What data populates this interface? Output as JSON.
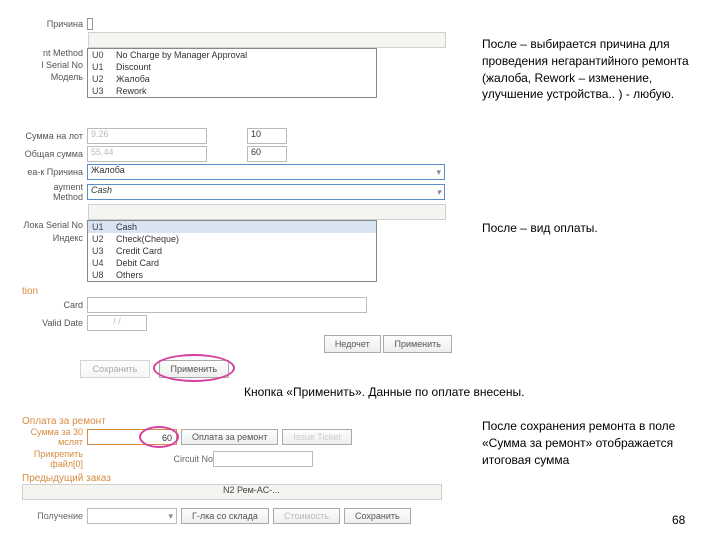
{
  "annotations": {
    "a1": "После – выбирается причина для проведения негарантийного ремонта (жалоба, Rework – изменение, улучшение устройства.. ) - любую.",
    "a2": "После – вид оплаты.",
    "a3": "Кнопка «Применить». Данные по оплате внесены.",
    "a4": "После сохранения ремонта в поле «Сумма за ремонт» отображается итоговая сумма"
  },
  "page_number": "68",
  "top": {
    "labels": {
      "reason": "Причина",
      "method": "nt Method",
      "serial": "l Serial No",
      "engine": "Модель"
    },
    "dropdown1": {
      "items": [
        {
          "code": "U0",
          "text": "No Charge by Manager Approval"
        },
        {
          "code": "U1",
          "text": "Discount"
        },
        {
          "code": "U2",
          "text": "Жалоба"
        },
        {
          "code": "U3",
          "text": "Rework"
        }
      ]
    },
    "rows": {
      "sumRepair": "Сумма на лот",
      "sumRepairVal": "9.26",
      "totalSum": "Общая сумма",
      "totalSumVal": "55.44",
      "colA": "10",
      "colB": "60",
      "reason2": "еа-к Причина",
      "reason2Val": "Жалоба",
      "payMethod": "ayment Method",
      "payMethodVal": "Cash",
      "serial2": "Лока Serial No",
      "index": "Индекс"
    },
    "dropdown2": {
      "items": [
        {
          "code": "U1",
          "text": "Cash"
        },
        {
          "code": "U2",
          "text": "Check(Cheque)"
        },
        {
          "code": "U3",
          "text": "Credit Card"
        },
        {
          "code": "U4",
          "text": "Debit Card"
        },
        {
          "code": "U8",
          "text": "Others"
        }
      ]
    },
    "tion": "tion",
    "cardLbl": "Card",
    "validLbl": "Valid Date",
    "validVal": "/ /",
    "btnClear": "Недочет",
    "btnApply": "Применить"
  },
  "mid": {
    "btnSave": "Сохранить",
    "btnApply": "Применить"
  },
  "bottom": {
    "section": "Оплата за ремонт",
    "sumZa30": "Сумма за 30 мслят",
    "val60": "60",
    "oplataRemont": "Оплата за ремонт",
    "issue": "Issue Ticket",
    "attach": "Прикрепить файл[0]",
    "circuit": "Circuit No",
    "prevOrder": "Предыдущий заказ",
    "uniqEngineer": "N2 Рем-AC-...",
    "receive": "Получение",
    "fromStock": "Г-лка со склада",
    "cost": "Стоимость",
    "save": "Сохранить"
  }
}
